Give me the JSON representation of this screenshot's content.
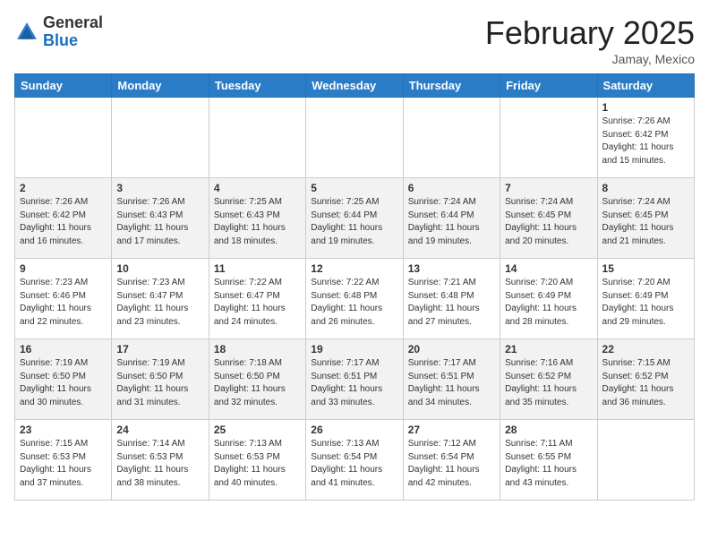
{
  "header": {
    "logo_general": "General",
    "logo_blue": "Blue",
    "month_title": "February 2025",
    "location": "Jamay, Mexico"
  },
  "days_of_week": [
    "Sunday",
    "Monday",
    "Tuesday",
    "Wednesday",
    "Thursday",
    "Friday",
    "Saturday"
  ],
  "weeks": [
    [
      {
        "day": "",
        "info": ""
      },
      {
        "day": "",
        "info": ""
      },
      {
        "day": "",
        "info": ""
      },
      {
        "day": "",
        "info": ""
      },
      {
        "day": "",
        "info": ""
      },
      {
        "day": "",
        "info": ""
      },
      {
        "day": "1",
        "info": "Sunrise: 7:26 AM\nSunset: 6:42 PM\nDaylight: 11 hours\nand 15 minutes."
      }
    ],
    [
      {
        "day": "2",
        "info": "Sunrise: 7:26 AM\nSunset: 6:42 PM\nDaylight: 11 hours\nand 16 minutes."
      },
      {
        "day": "3",
        "info": "Sunrise: 7:26 AM\nSunset: 6:43 PM\nDaylight: 11 hours\nand 17 minutes."
      },
      {
        "day": "4",
        "info": "Sunrise: 7:25 AM\nSunset: 6:43 PM\nDaylight: 11 hours\nand 18 minutes."
      },
      {
        "day": "5",
        "info": "Sunrise: 7:25 AM\nSunset: 6:44 PM\nDaylight: 11 hours\nand 19 minutes."
      },
      {
        "day": "6",
        "info": "Sunrise: 7:24 AM\nSunset: 6:44 PM\nDaylight: 11 hours\nand 19 minutes."
      },
      {
        "day": "7",
        "info": "Sunrise: 7:24 AM\nSunset: 6:45 PM\nDaylight: 11 hours\nand 20 minutes."
      },
      {
        "day": "8",
        "info": "Sunrise: 7:24 AM\nSunset: 6:45 PM\nDaylight: 11 hours\nand 21 minutes."
      }
    ],
    [
      {
        "day": "9",
        "info": "Sunrise: 7:23 AM\nSunset: 6:46 PM\nDaylight: 11 hours\nand 22 minutes."
      },
      {
        "day": "10",
        "info": "Sunrise: 7:23 AM\nSunset: 6:47 PM\nDaylight: 11 hours\nand 23 minutes."
      },
      {
        "day": "11",
        "info": "Sunrise: 7:22 AM\nSunset: 6:47 PM\nDaylight: 11 hours\nand 24 minutes."
      },
      {
        "day": "12",
        "info": "Sunrise: 7:22 AM\nSunset: 6:48 PM\nDaylight: 11 hours\nand 26 minutes."
      },
      {
        "day": "13",
        "info": "Sunrise: 7:21 AM\nSunset: 6:48 PM\nDaylight: 11 hours\nand 27 minutes."
      },
      {
        "day": "14",
        "info": "Sunrise: 7:20 AM\nSunset: 6:49 PM\nDaylight: 11 hours\nand 28 minutes."
      },
      {
        "day": "15",
        "info": "Sunrise: 7:20 AM\nSunset: 6:49 PM\nDaylight: 11 hours\nand 29 minutes."
      }
    ],
    [
      {
        "day": "16",
        "info": "Sunrise: 7:19 AM\nSunset: 6:50 PM\nDaylight: 11 hours\nand 30 minutes."
      },
      {
        "day": "17",
        "info": "Sunrise: 7:19 AM\nSunset: 6:50 PM\nDaylight: 11 hours\nand 31 minutes."
      },
      {
        "day": "18",
        "info": "Sunrise: 7:18 AM\nSunset: 6:50 PM\nDaylight: 11 hours\nand 32 minutes."
      },
      {
        "day": "19",
        "info": "Sunrise: 7:17 AM\nSunset: 6:51 PM\nDaylight: 11 hours\nand 33 minutes."
      },
      {
        "day": "20",
        "info": "Sunrise: 7:17 AM\nSunset: 6:51 PM\nDaylight: 11 hours\nand 34 minutes."
      },
      {
        "day": "21",
        "info": "Sunrise: 7:16 AM\nSunset: 6:52 PM\nDaylight: 11 hours\nand 35 minutes."
      },
      {
        "day": "22",
        "info": "Sunrise: 7:15 AM\nSunset: 6:52 PM\nDaylight: 11 hours\nand 36 minutes."
      }
    ],
    [
      {
        "day": "23",
        "info": "Sunrise: 7:15 AM\nSunset: 6:53 PM\nDaylight: 11 hours\nand 37 minutes."
      },
      {
        "day": "24",
        "info": "Sunrise: 7:14 AM\nSunset: 6:53 PM\nDaylight: 11 hours\nand 38 minutes."
      },
      {
        "day": "25",
        "info": "Sunrise: 7:13 AM\nSunset: 6:53 PM\nDaylight: 11 hours\nand 40 minutes."
      },
      {
        "day": "26",
        "info": "Sunrise: 7:13 AM\nSunset: 6:54 PM\nDaylight: 11 hours\nand 41 minutes."
      },
      {
        "day": "27",
        "info": "Sunrise: 7:12 AM\nSunset: 6:54 PM\nDaylight: 11 hours\nand 42 minutes."
      },
      {
        "day": "28",
        "info": "Sunrise: 7:11 AM\nSunset: 6:55 PM\nDaylight: 11 hours\nand 43 minutes."
      },
      {
        "day": "",
        "info": ""
      }
    ]
  ]
}
